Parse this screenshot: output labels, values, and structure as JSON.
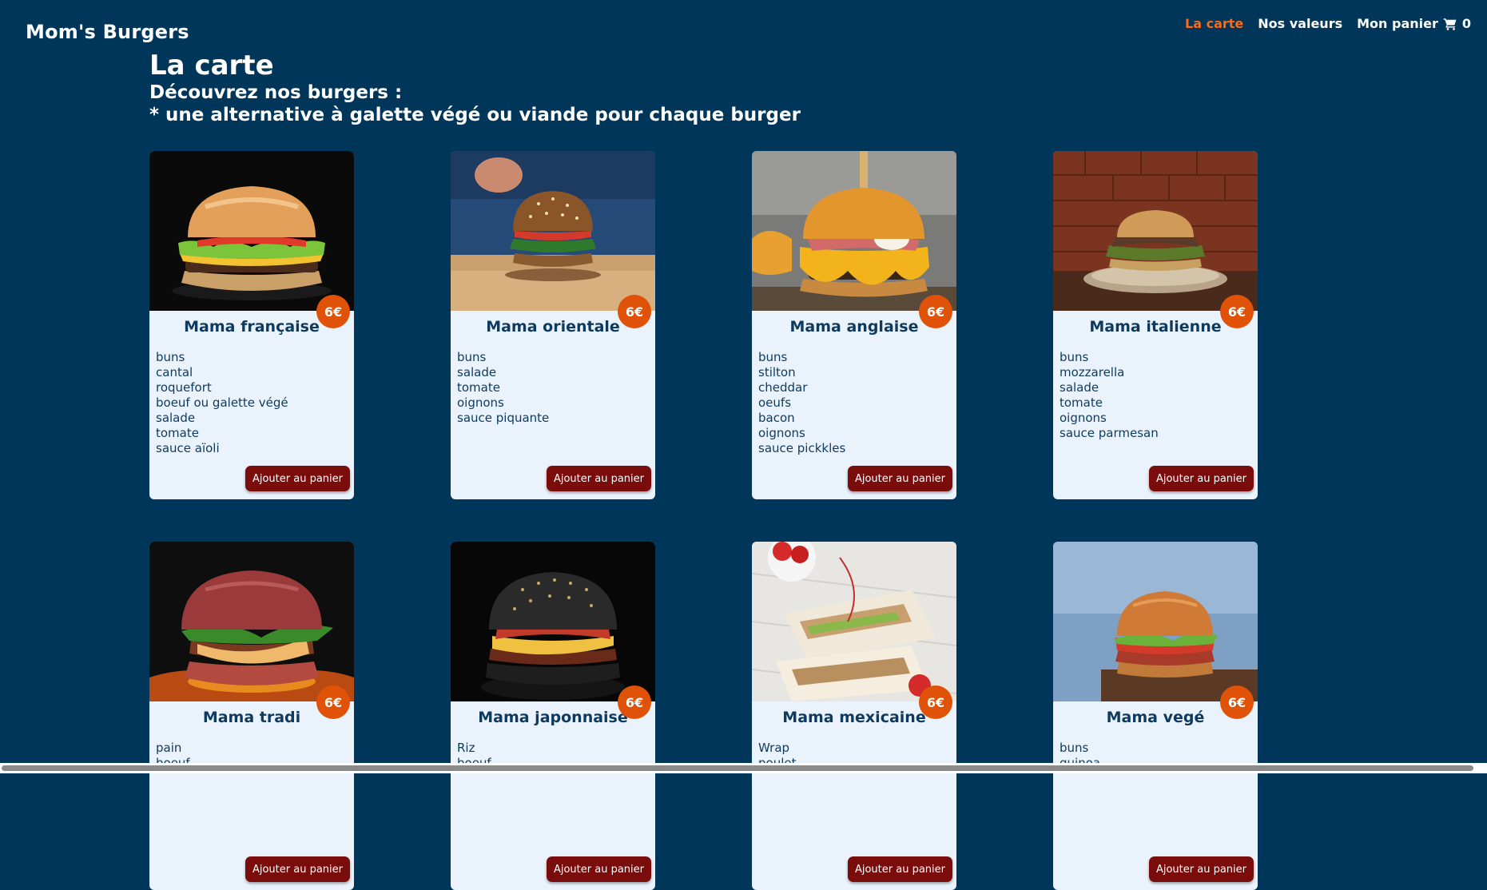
{
  "header": {
    "brand": "Mom's Burgers",
    "nav": {
      "menu": "La carte",
      "values": "Nos valeurs",
      "cart_label": "Mon panier",
      "cart_icon": "shopping-cart-icon",
      "cart_count": "0"
    }
  },
  "page": {
    "title": "La carte",
    "subtitle_line1": "Découvrez nos burgers :",
    "subtitle_line2": "* une alternative à galette végé ou viande pour chaque burger"
  },
  "colors": {
    "background": "#003659",
    "nav_active": "#ff6a13",
    "price_badge": "#e05207",
    "add_button": "#7a0c0c",
    "card_bg": "#eaf2fb",
    "card_text": "#0e3a5e"
  },
  "cards": [
    {
      "name": "Mama française",
      "price": "6€",
      "ingredients": [
        "buns",
        "cantal",
        "roquefort",
        "boeuf ou galette végé",
        "salade",
        "tomate",
        "sauce aïoli"
      ],
      "button": "Ajouter au panier"
    },
    {
      "name": "Mama orientale",
      "price": "6€",
      "ingredients": [
        "buns",
        "salade",
        "tomate",
        "oignons",
        "sauce piquante"
      ],
      "button": "Ajouter au panier"
    },
    {
      "name": "Mama anglaise",
      "price": "6€",
      "ingredients": [
        "buns",
        "stilton",
        "cheddar",
        "oeufs",
        "bacon",
        "oignons",
        "sauce pickkles"
      ],
      "button": "Ajouter au panier"
    },
    {
      "name": "Mama italienne",
      "price": "6€",
      "ingredients": [
        "buns",
        "mozzarella",
        "salade",
        "tomate",
        "oignons",
        "sauce parmesan"
      ],
      "button": "Ajouter au panier"
    },
    {
      "name": "Mama tradi",
      "price": "6€",
      "ingredients": [
        "pain",
        "boeuf"
      ],
      "button": "Ajouter au panier"
    },
    {
      "name": "Mama japonnaise",
      "price": "6€",
      "ingredients": [
        "Riz",
        "boeuf"
      ],
      "button": "Ajouter au panier"
    },
    {
      "name": "Mama mexicaine",
      "price": "6€",
      "ingredients": [
        "Wrap",
        "poulet"
      ],
      "button": "Ajouter au panier"
    },
    {
      "name": "Mama vegé",
      "price": "6€",
      "ingredients": [
        "buns",
        "quinoa"
      ],
      "button": "Ajouter au panier"
    }
  ]
}
